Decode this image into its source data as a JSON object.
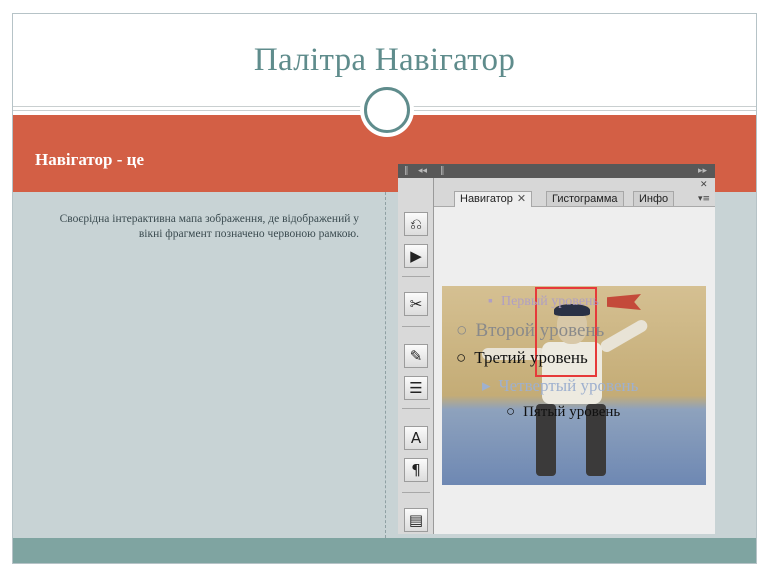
{
  "slide": {
    "title": "Палітра Навігатор",
    "subheading": "Навігатор - це",
    "description": "Своєрідна інтерактивна мапа зображення, де відображений у вікні фрагмент позначено червоною рамкою."
  },
  "panel": {
    "tabs": [
      {
        "label": "Навигатор",
        "close": "✕"
      },
      {
        "label": "Гистограмма"
      },
      {
        "label": "Инфо"
      }
    ],
    "collapse_left": "◂◂",
    "collapse_right": "▸▸",
    "panel_close": "✕",
    "panel_menu": "▾≡"
  },
  "tools": [
    {
      "icon": "history-brush-icon",
      "glyph": "⎌"
    },
    {
      "icon": "play-action-icon",
      "glyph": "▶"
    },
    {
      "icon": "tools-icon",
      "glyph": "✂"
    },
    {
      "icon": "brush-preset-icon",
      "glyph": "✎"
    },
    {
      "icon": "clone-source-icon",
      "glyph": "☰"
    },
    {
      "icon": "character-icon",
      "glyph": "A"
    },
    {
      "icon": "paragraph-icon",
      "glyph": "¶"
    },
    {
      "icon": "notes-icon",
      "glyph": "▤"
    }
  ],
  "overlay_text": {
    "level1": "Первый уровень",
    "level2": "Второй уровень",
    "level3": "Третий уровень",
    "level4": "Четвертый уровень",
    "level5": "Пятый уровень"
  },
  "colors": {
    "title": "#5f8c8c",
    "red_band": "#d35f45",
    "body_bg": "#c8d3d5",
    "bottom_band": "#7fa4a1",
    "nav_frame": "#e63a3a"
  }
}
